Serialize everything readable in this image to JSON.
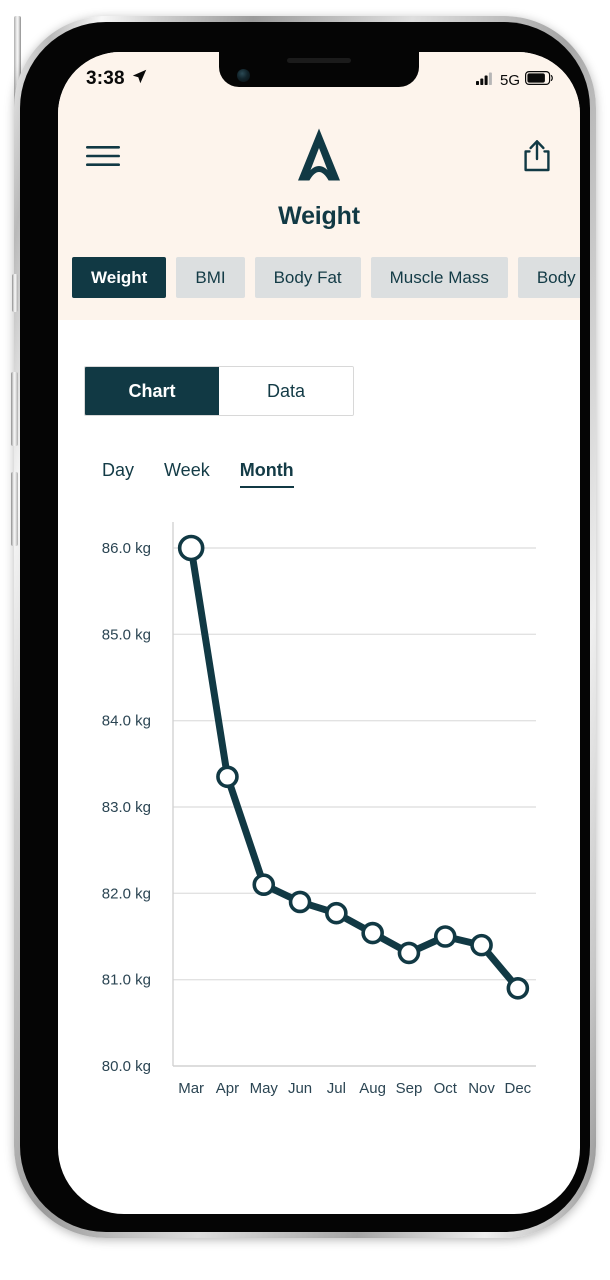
{
  "status_bar": {
    "time": "3:38",
    "location_icon": "location-arrow-icon",
    "signal_icon": "cellular-bars-icon",
    "network": "5G",
    "battery_icon": "battery-icon"
  },
  "header": {
    "menu_icon": "hamburger-menu-icon",
    "logo_icon": "brand-a-arch-logo-icon",
    "share_icon": "share-upload-icon",
    "title": "Weight"
  },
  "metric_tabs": {
    "items": [
      {
        "label": "Weight",
        "active": true
      },
      {
        "label": "BMI",
        "active": false
      },
      {
        "label": "Body Fat",
        "active": false
      },
      {
        "label": "Muscle Mass",
        "active": false
      },
      {
        "label": "Body Water",
        "active": false
      }
    ]
  },
  "view_toggle": {
    "options": [
      {
        "label": "Chart",
        "active": true
      },
      {
        "label": "Data",
        "active": false
      }
    ]
  },
  "period_selector": {
    "options": [
      {
        "label": "Day",
        "active": false
      },
      {
        "label": "Week",
        "active": false
      },
      {
        "label": "Month",
        "active": true
      }
    ]
  },
  "colors": {
    "brand_dark": "#113944",
    "header_bg": "#fdf4ec",
    "tab_inactive_bg": "#dcdfe0",
    "gridline": "#e2e2e2",
    "axis_text": "#2b4553"
  },
  "chart_data": {
    "type": "line",
    "title": "Weight",
    "xlabel": "",
    "ylabel": "",
    "unit": "kg",
    "grid": true,
    "legend": "none",
    "ylim": [
      80.0,
      86.0
    ],
    "ytick_labels": [
      "86.0 kg",
      "85.0 kg",
      "84.0 kg",
      "83.0 kg",
      "82.0 kg",
      "81.0 kg",
      "80.0 kg"
    ],
    "ytick_values": [
      86.0,
      85.0,
      84.0,
      83.0,
      82.0,
      81.0,
      80.0
    ],
    "categories": [
      "Mar",
      "Apr",
      "May",
      "Jun",
      "Jul",
      "Aug",
      "Sep",
      "Oct",
      "Nov",
      "Dec"
    ],
    "series": [
      {
        "name": "Weight",
        "color": "#113944",
        "marker": "open-circle",
        "values": [
          86.0,
          83.35,
          82.1,
          81.9,
          81.77,
          81.54,
          81.31,
          81.5,
          81.4,
          80.9
        ]
      }
    ]
  }
}
